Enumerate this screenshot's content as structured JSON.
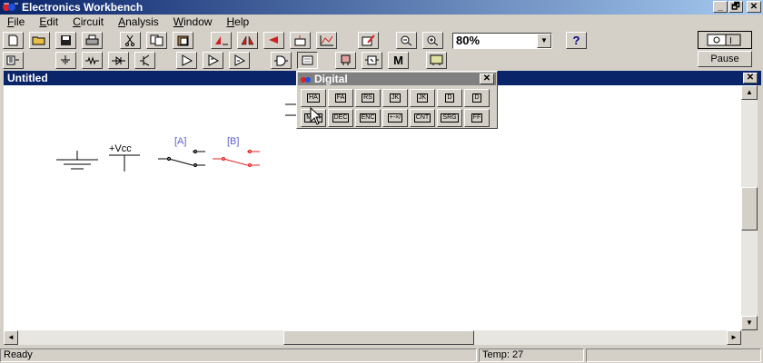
{
  "window": {
    "title": "Electronics Workbench"
  },
  "caption_buttons": [
    "_",
    "🗗",
    "✕"
  ],
  "menu": [
    {
      "label": "File",
      "key": "F",
      "rest": "ile"
    },
    {
      "label": "Edit",
      "key": "E",
      "rest": "dit"
    },
    {
      "label": "Circuit",
      "key": "C",
      "rest": "ircuit"
    },
    {
      "label": "Analysis",
      "key": "A",
      "rest": "nalysis"
    },
    {
      "label": "Window",
      "key": "W",
      "rest": "indow"
    },
    {
      "label": "Help",
      "key": "H",
      "rest": "elp"
    }
  ],
  "toolbar": {
    "zoom_value": "80%",
    "help_label": "?"
  },
  "parts_bin": {
    "m_label": "M"
  },
  "pause_label": "Pause",
  "document": {
    "title": "Untitled",
    "close": "✕"
  },
  "palette": {
    "title": "Digital",
    "close": "✕",
    "row1": [
      "HA",
      "FA",
      "RS",
      "JK",
      "JK",
      "D",
      "D"
    ],
    "row2": [
      "MUX",
      "DEC",
      "ENC",
      "+-×/",
      "CNT",
      "SRG",
      "FF"
    ]
  },
  "canvas": {
    "vcc_label": "+Vcc",
    "switch_a_label": "[A]",
    "switch_b_label": "[B]"
  },
  "status": {
    "left": "Ready",
    "temp": "Temp:  27"
  },
  "colors": {
    "title_bar": "#0a246a",
    "inactive_bar": "#808080",
    "switch_a": "#000000",
    "switch_b": "#e02020",
    "label_blue": "#6060d0"
  }
}
